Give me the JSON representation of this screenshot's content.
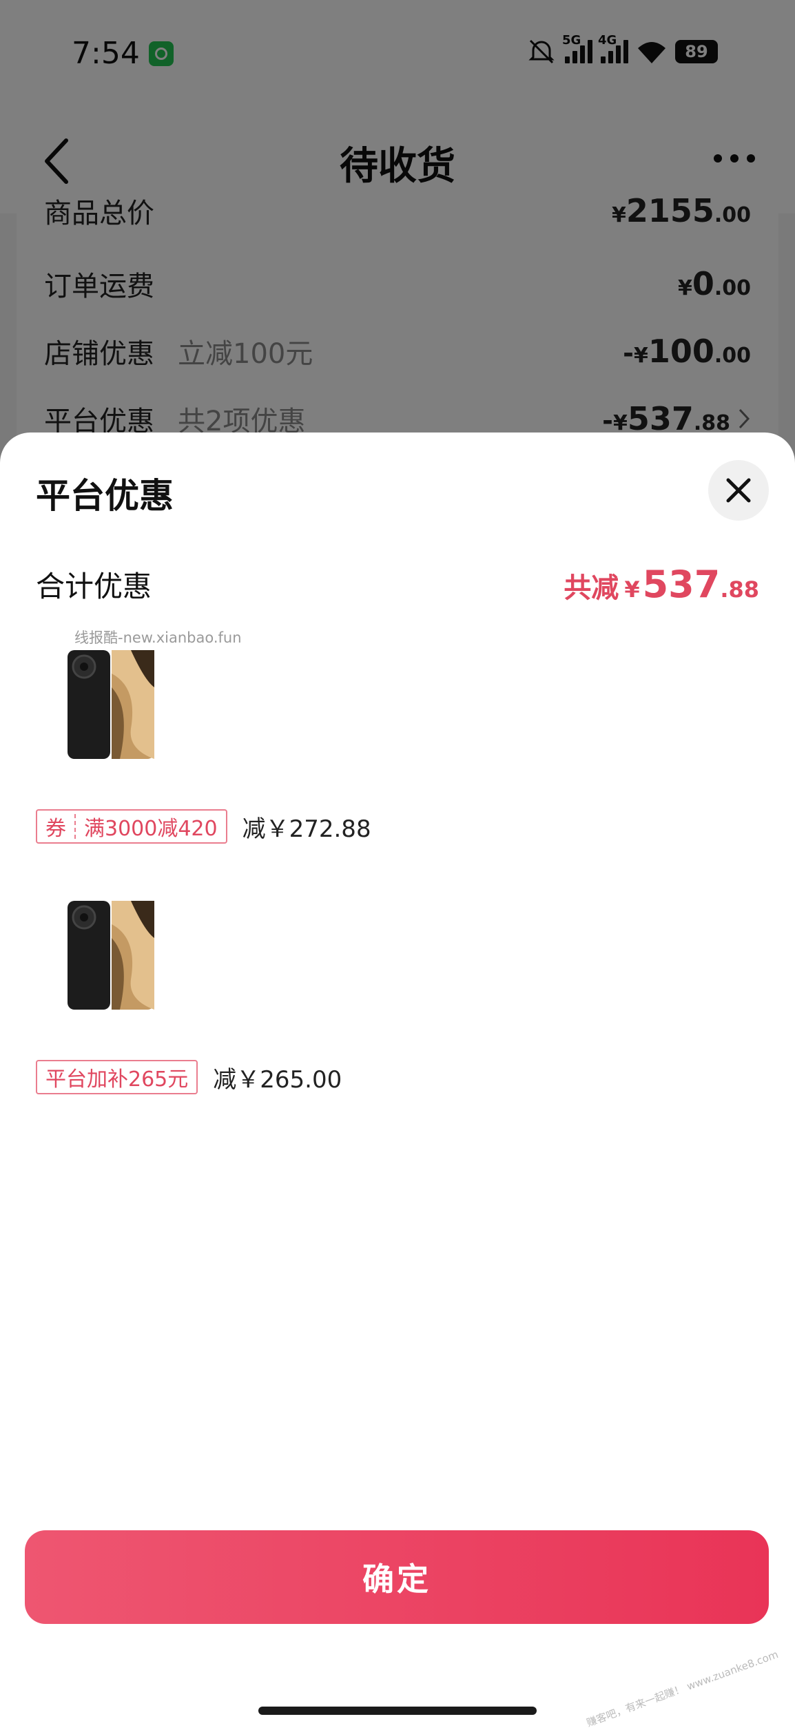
{
  "status_bar": {
    "time": "7:54",
    "net1": "5G",
    "net2": "4G",
    "battery": "89"
  },
  "nav": {
    "title": "待收货"
  },
  "order_summary": {
    "rows": [
      {
        "label": "商品总价",
        "sub": "",
        "prefix": "",
        "currency": "¥",
        "int": "2155",
        "dec": ".00"
      },
      {
        "label": "订单运费",
        "sub": "",
        "prefix": "",
        "currency": "¥",
        "int": "0",
        "dec": ".00"
      },
      {
        "label": "店铺优惠",
        "sub": "立减100元",
        "prefix": "-",
        "currency": "¥",
        "int": "100",
        "dec": ".00"
      },
      {
        "label": "平台优惠",
        "sub": "共2项优惠",
        "prefix": "-",
        "currency": "¥",
        "int": "537",
        "dec": ".88"
      }
    ]
  },
  "sheet": {
    "title": "平台优惠",
    "total_label": "合计优惠",
    "total_prefix": "共减",
    "total_currency": "¥",
    "total_int": "537",
    "total_dec": ".88",
    "watermark": "线报酷-new.xianbao.fun",
    "items": [
      {
        "tag_left": "券",
        "tag_right": "满3000减420",
        "discount": "减￥272.88"
      },
      {
        "tag": "平台加补265元",
        "discount": "减￥265.00"
      }
    ],
    "confirm_label": "确定"
  },
  "corner_watermark": "赚客吧，有来一起赚！ www.zuanke8.com",
  "colors": {
    "accent": "#e0475f",
    "button_start": "#ee5671",
    "button_end": "#e93457"
  }
}
